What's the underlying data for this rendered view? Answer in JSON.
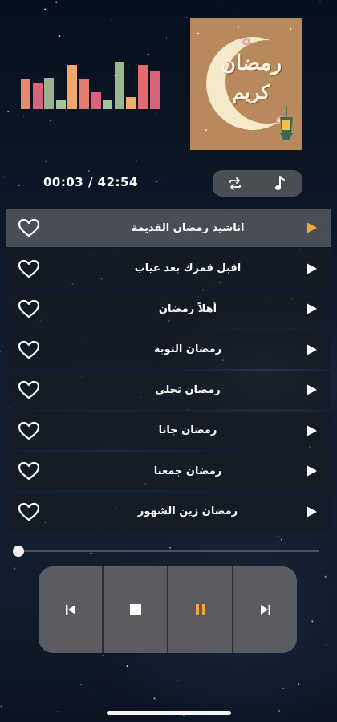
{
  "player": {
    "time_display": "00:03 / 42:54",
    "progress_fraction": 0.0
  },
  "equalizer": {
    "levels": [
      0.62,
      0.55,
      0.65,
      0.18,
      0.92,
      0.62,
      0.35,
      0.18,
      0.98,
      0.25,
      0.92,
      0.8
    ],
    "colors": [
      "#e78b6d",
      "#d9637d",
      "#9bb18c",
      "#a6c49a",
      "#f0a76c",
      "#e07a6e",
      "#d9637d",
      "#a6c49a",
      "#98b88e",
      "#f3ae6c",
      "#e46a72",
      "#d9637d"
    ]
  },
  "album_art": {
    "line1": "رمضان",
    "line2": "كريم",
    "background_color": "#b9895e"
  },
  "modes": {
    "icons": [
      "repeat-icon",
      "music-note-icon"
    ]
  },
  "playlist": {
    "active_index": 0,
    "accent_color": "#f0a838",
    "tracks": [
      {
        "title": "اناشيد رمضان القديمة"
      },
      {
        "title": "اقبل قمرك بعد غياب"
      },
      {
        "title": "أهلاً رمضان"
      },
      {
        "title": "رمضان التوبة"
      },
      {
        "title": "رمضان تجلى"
      },
      {
        "title": "رمضان جانا"
      },
      {
        "title": "رمضان جمعنا"
      },
      {
        "title": "رمضان زين الشهور"
      }
    ]
  },
  "controls": {
    "icons": [
      "previous-icon",
      "stop-icon",
      "pause-icon",
      "next-icon"
    ],
    "pause_color": "#f0a838"
  }
}
